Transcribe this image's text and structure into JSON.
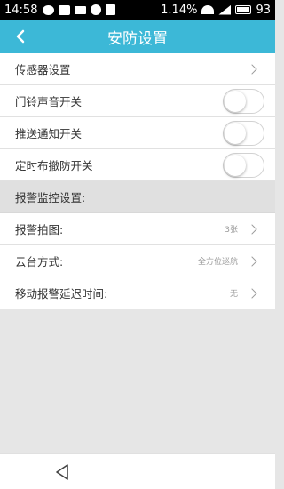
{
  "status_bar": {
    "time": "14:58",
    "battery_percent_text": "1.14%",
    "battery_level": "93",
    "icons": [
      "chat-bubble-icon",
      "image-icon",
      "mail-icon",
      "face-icon",
      "calendar-icon",
      "wifi-icon",
      "signal-icon",
      "battery-icon"
    ]
  },
  "header": {
    "title": "安防设置",
    "back_icon": "chevron-left-icon",
    "background_color": "#3cb8d7"
  },
  "settings": {
    "sensor_settings": "传感器设置",
    "doorbell_sound": {
      "label": "门铃声音开关",
      "on": false
    },
    "push_notification": {
      "label": "推送通知开关",
      "on": false
    },
    "scheduled_arm": {
      "label": "定时布撤防开关",
      "on": false
    }
  },
  "alarm_section": {
    "title": "报警监控设置:",
    "photos": {
      "label": "报警拍图:",
      "value": "3张"
    },
    "ptz_mode": {
      "label": "云台方式:",
      "value": "全方位巡航"
    },
    "motion_delay": {
      "label": "移动报警延迟时间:",
      "value": "无"
    }
  },
  "bottom_bar": {
    "back_icon": "triangle-back-icon"
  }
}
